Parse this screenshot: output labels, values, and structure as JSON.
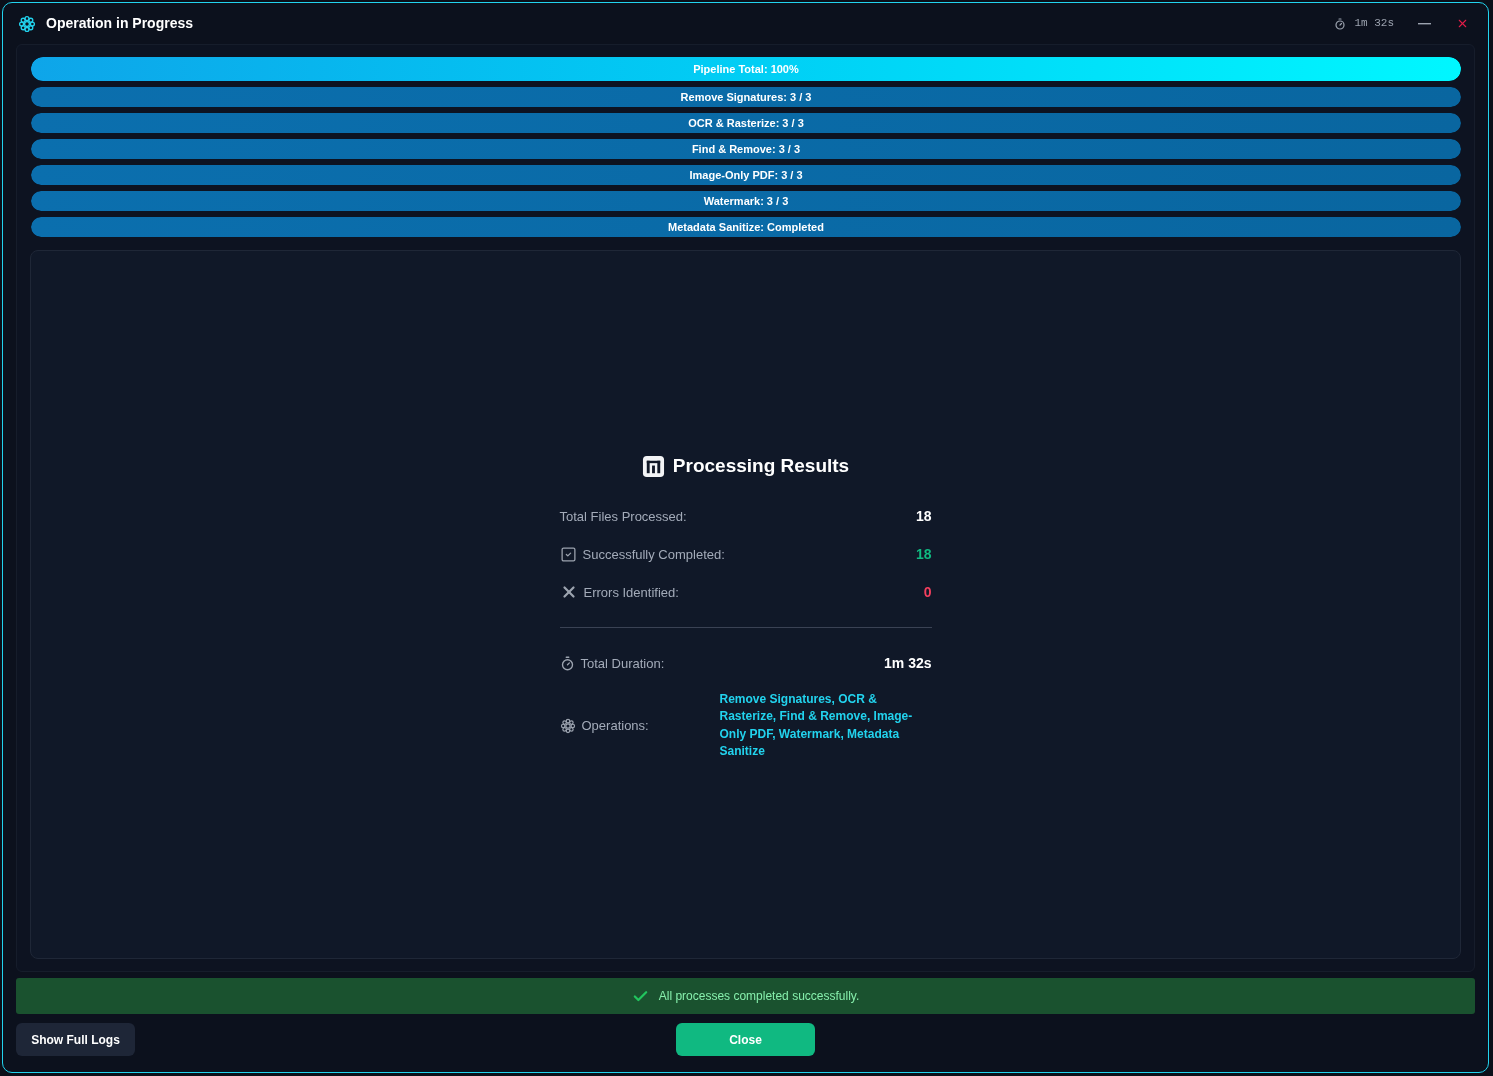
{
  "window": {
    "title": "Operation in Progress",
    "timer": "1m 32s"
  },
  "progress_bars": [
    {
      "kind": "total",
      "label": "Pipeline Total: 100%",
      "level": 1
    },
    {
      "kind": "step",
      "label": "Remove Signatures: 3 / 3",
      "level": 1
    },
    {
      "kind": "step",
      "label": "OCR & Rasterize: 3 / 3",
      "level": 1
    },
    {
      "kind": "step",
      "label": "Find & Remove: 3 / 3",
      "level": 1
    },
    {
      "kind": "step",
      "label": "Image-Only PDF: 3 / 3",
      "level": 1
    },
    {
      "kind": "step",
      "label": "Watermark: 3 / 3",
      "level": 1
    },
    {
      "kind": "step",
      "label": "Metadata Sanitize: Completed",
      "level": 1
    }
  ],
  "results": {
    "title": "Processing Results",
    "counts": [
      {
        "kind": "total",
        "label": "Total Files Processed:",
        "value": "18"
      },
      {
        "kind": "success",
        "label": "Successfully Completed:",
        "value": "18"
      },
      {
        "kind": "error",
        "label": "Errors Identified:",
        "value": "0"
      }
    ],
    "details": [
      {
        "kind": "duration",
        "label": "Total Duration:",
        "value": "1m 32s"
      },
      {
        "kind": "operations",
        "label": "Operations:",
        "value": "Remove Signatures, OCR & Rasterize, Find & Remove, Image-Only PDF, Watermark, Metadata Sanitize"
      }
    ]
  },
  "status_message": "All processes completed successfully.",
  "buttons": [
    {
      "kind": "secondary",
      "label": "Show Full Logs"
    },
    {
      "kind": "primary",
      "label": "Close"
    }
  ]
}
